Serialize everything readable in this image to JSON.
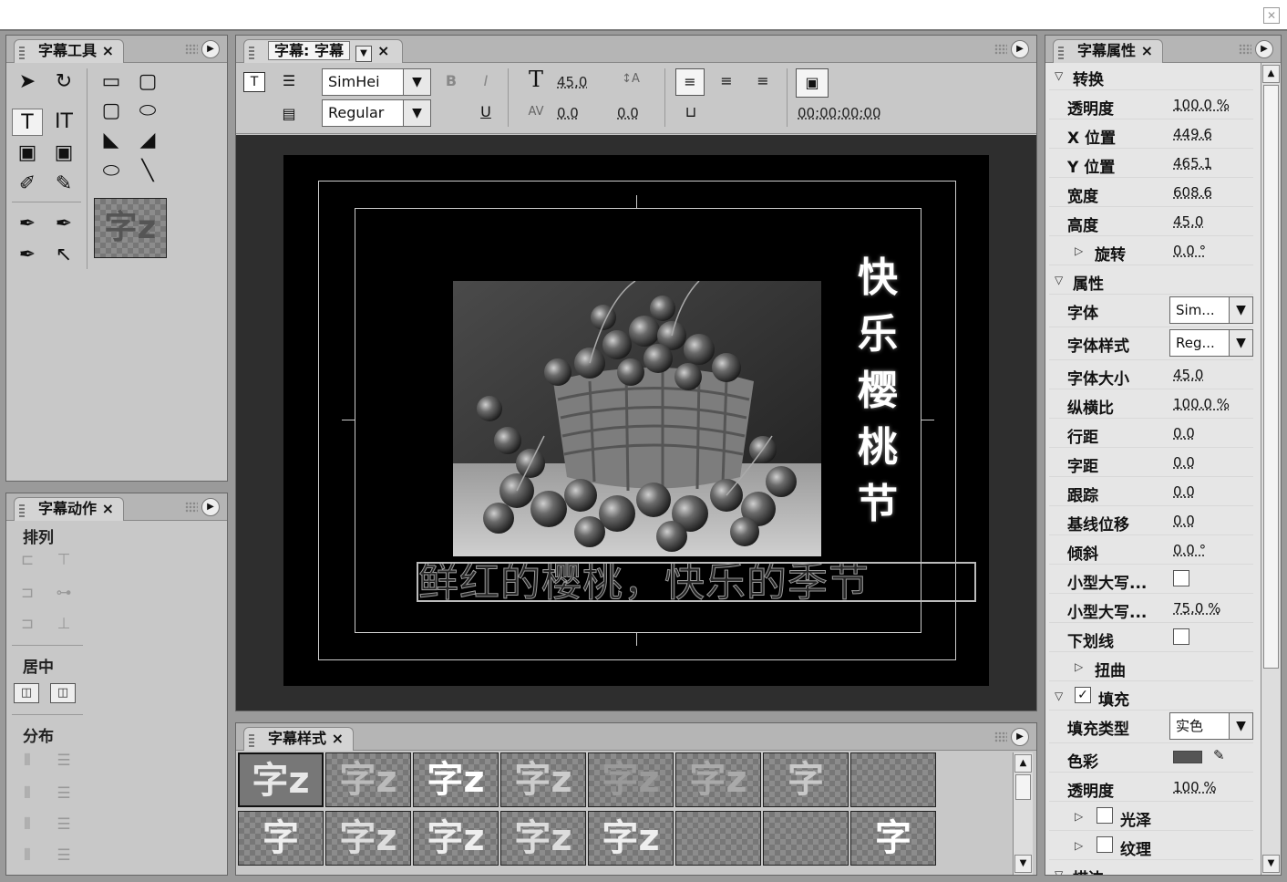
{
  "tools_panel": {
    "tab": "字幕工具",
    "close": "×"
  },
  "actions_panel": {
    "tab": "字幕动作",
    "close": "×",
    "align_label": "排列",
    "center_label": "居中",
    "distribute_label": "分布"
  },
  "title_panel": {
    "tab": "字幕: 字幕",
    "close": "×",
    "font_family": "SimHei",
    "font_style": "Regular",
    "bold": "B",
    "italic": "I",
    "underline": "U",
    "font_size": "45.0",
    "kerning": "0.0",
    "leading": "0.0",
    "timecode": "00:00:00:00",
    "vertical_text": [
      "快",
      "乐",
      "樱",
      "桃",
      "节"
    ],
    "subtitle_text": "鲜红的樱桃，快乐的季节",
    "glyph_T": "T",
    "glyph_IT": "IT"
  },
  "styles_panel": {
    "tab": "字幕样式",
    "close": "×",
    "row1": [
      "字z",
      "字z",
      "字z",
      "字z",
      "字z",
      "字z",
      "字",
      ""
    ],
    "row2": [
      "字",
      "字z",
      "字z",
      "字z",
      "字z",
      "",
      "",
      "字"
    ]
  },
  "props_panel": {
    "tab": "字幕属性",
    "close": "×",
    "transform": {
      "header": "转换",
      "opacity_label": "透明度",
      "opacity": "100.0 %",
      "x_label": "X 位置",
      "x": "449.6",
      "y_label": "Y 位置",
      "y": "465.1",
      "width_label": "宽度",
      "width": "608.6",
      "height_label": "高度",
      "height": "45.0",
      "rotation_label": "旋转",
      "rotation": "0.0 °"
    },
    "properties": {
      "header": "属性",
      "font_label": "字体",
      "font": "Sim...",
      "style_label": "字体样式",
      "style": "Reg...",
      "size_label": "字体大小",
      "size": "45.0",
      "aspect_label": "纵横比",
      "aspect": "100.0 %",
      "leading_label": "行距",
      "leading": "0.0",
      "kerning_label": "字距",
      "kerning": "0.0",
      "tracking_label": "跟踪",
      "tracking": "0.0",
      "baseline_label": "基线位移",
      "baseline": "0.0",
      "slant_label": "倾斜",
      "slant": "0.0 °",
      "smallcaps_label": "小型大写...",
      "smallcaps_size_label": "小型大写...",
      "smallcaps_size": "75.0 %",
      "underline_label": "下划线",
      "distort_label": "扭曲"
    },
    "fill": {
      "header": "填充",
      "type_label": "填充类型",
      "type": "实色",
      "color_label": "色彩",
      "color": "#555555",
      "opacity_label": "透明度",
      "opacity": "100 %",
      "sheen_label": "光泽",
      "texture_label": "纹理"
    },
    "stroke": {
      "header": "描边"
    }
  }
}
